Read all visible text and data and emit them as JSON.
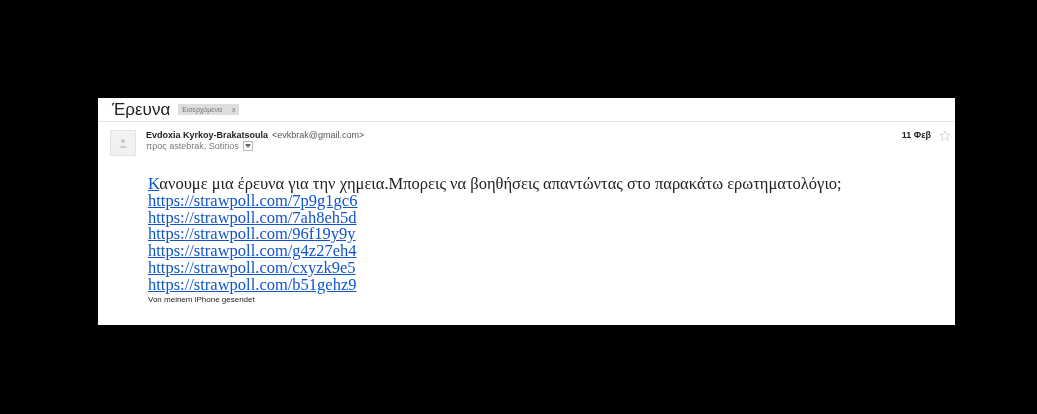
{
  "email": {
    "subject": "Έρευνα",
    "label": {
      "text": "Εισερχόμενα",
      "close": "x"
    },
    "sender": {
      "name": "Evdoxia Kyrkoy-Brakatsoula",
      "address": "<evkbrak@gmail.com>",
      "recipients": "προς astebrak, Sotirios"
    },
    "date": "11 Φεβ",
    "starred": false,
    "body": {
      "lead_link": "Κ",
      "text": "ανουμε μια έρευνα για την χημεια.Μπορεις να βοηθήσεις απαντώντας στο παρακάτω ερωτηματολόγιο;",
      "links": [
        "https://strawpoll.com/7p9g1gc6",
        "https://strawpoll.com/7ah8eh5d",
        "https://strawpoll.com/96f19y9y",
        "https://strawpoll.com/g4z27eh4",
        "https://strawpoll.com/cxyzk9e5",
        "https://strawpoll.com/b51gehz9"
      ],
      "signature": "Von meinem iPhone gesendet"
    }
  }
}
